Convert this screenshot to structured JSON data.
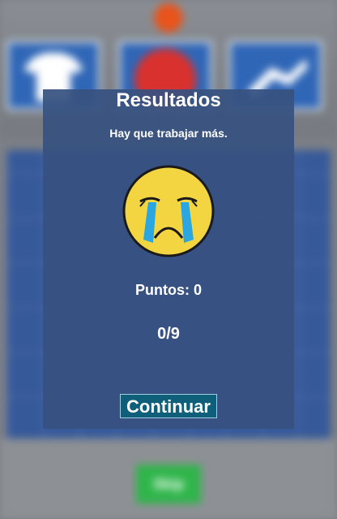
{
  "background": {
    "button_label": "Skip"
  },
  "result": {
    "title": "Resultados",
    "message": "Hay que trabajar más.",
    "face_icon": "crying-face-icon",
    "points_label": "Puntos: 0",
    "score_label": "0/9",
    "continue_label": "Continuar"
  },
  "colors": {
    "panel": "#375280",
    "button": "#0f5f7a",
    "face": "#f2d541",
    "tears": "#2aa6e0"
  }
}
